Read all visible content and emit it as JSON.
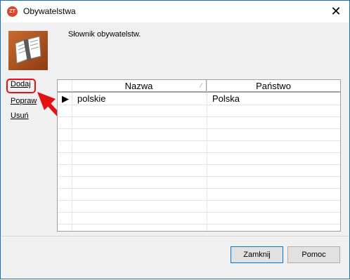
{
  "window": {
    "title": "Obywatelstwa",
    "app_icon_text": "ZT",
    "close_glyph": "✕"
  },
  "description": "Słownik obywatelstw.",
  "side_actions": {
    "add": "Dodaj",
    "edit": "Popraw",
    "delete": "Usuń"
  },
  "grid": {
    "columns": [
      "Nazwa",
      "Państwo"
    ],
    "rows": [
      {
        "name": "polskie",
        "country": "Polska",
        "selected": true
      }
    ]
  },
  "buttons": {
    "close": "Zamknij",
    "help": "Pomoc"
  },
  "colors": {
    "accent": "#e3120e",
    "window_border": "#1e6fbf"
  }
}
